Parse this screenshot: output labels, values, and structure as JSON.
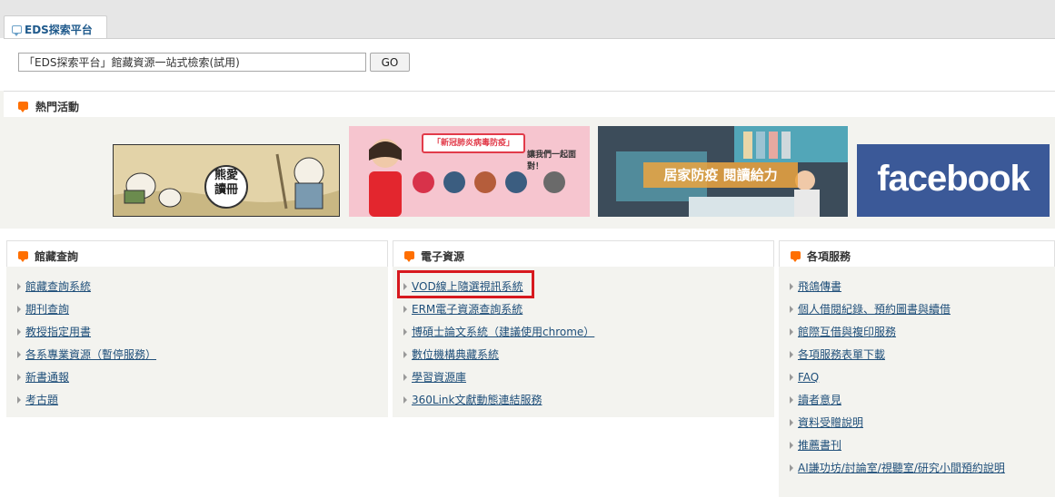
{
  "eds": {
    "tab_label": "EDS探索平台",
    "search_value": "「EDS探索平台」館藏資源一站式檢索(試用)",
    "go_label": "GO"
  },
  "hot": {
    "title": "熱門活動",
    "banners": {
      "bear_text": "熊愛\n讀冊",
      "covid_headline": "「新冠肺炎病毒防疫」",
      "covid_sub": "讓我們一起面對！",
      "home_headline": "居家防疫 閱讀給力",
      "facebook_text": "facebook"
    }
  },
  "catalog": {
    "title": "館藏查詢",
    "items": [
      "館藏查詢系統",
      "期刊查詢",
      "教授指定用書",
      "各系專業資源（暫停服務）",
      "新書通報",
      "考古題"
    ]
  },
  "eresources": {
    "title": "電子資源",
    "items": [
      "VOD線上隨選視訊系統",
      "ERM電子資源查詢系統",
      "博碩士論文系統（建議使用chrome）",
      "數位機構典藏系統",
      "學習資源庫",
      "360Link文獻動態連結服務"
    ]
  },
  "services": {
    "title": "各項服務",
    "items": [
      "飛鴿傳書",
      "個人借閱紀錄、預約圖書與續借",
      "館際互借與複印服務",
      "各項服務表單下載",
      "FAQ",
      "讀者意見",
      "資料受贈說明",
      "推薦書刊",
      "AI謙功坊/討論室/視聽室/研究小間預約說明"
    ]
  },
  "colors": {
    "accent_orange": "#ff6f00",
    "link_blue": "#1f4f7a",
    "highlight_red": "#d7191f",
    "facebook_blue": "#3b5998"
  }
}
